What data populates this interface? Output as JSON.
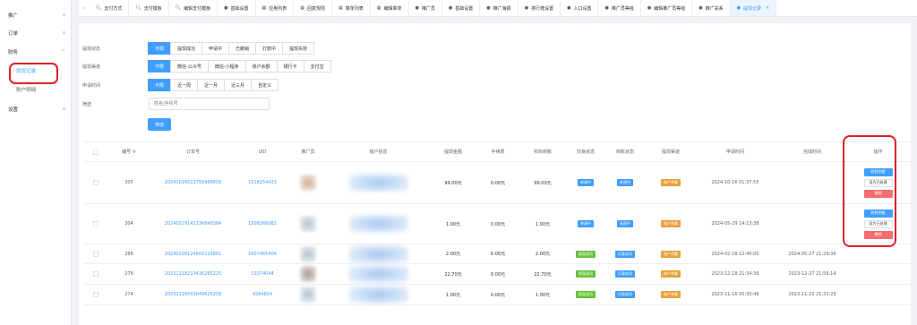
{
  "sidebar": {
    "items": [
      {
        "label": "推广",
        "chevron": "v"
      },
      {
        "label": "订单",
        "chevron": "v"
      },
      {
        "label": "财务",
        "chevron": "^"
      },
      {
        "label": "设置",
        "chevron": "v"
      }
    ],
    "sub_items": [
      {
        "label": "提现记录",
        "active": true
      },
      {
        "label": "账户明细",
        "active": false
      }
    ]
  },
  "tabs": {
    "left_arrow": "‹",
    "items": [
      {
        "label": "支付方式",
        "icon": "search-icon"
      },
      {
        "label": "支付模板",
        "icon": "search-icon"
      },
      {
        "label": "编辑支付模板",
        "icon": "search-icon"
      },
      {
        "label": "基础设置",
        "icon": "dot-icon"
      },
      {
        "label": "应用列表",
        "icon": "grid-icon"
      },
      {
        "label": "回复规则",
        "icon": "grid-icon"
      },
      {
        "label": "菜单列表",
        "icon": "grid-icon"
      },
      {
        "label": "编辑菜单",
        "icon": "grid-icon"
      },
      {
        "label": "推广员",
        "icon": "dot-icon"
      },
      {
        "label": "基础设置",
        "icon": "dot-icon"
      },
      {
        "label": "推广海报",
        "icon": "dot-icon"
      },
      {
        "label": "排行榜设置",
        "icon": "dot-icon"
      },
      {
        "label": "入口设置",
        "icon": "dot-icon"
      },
      {
        "label": "推广员等级",
        "icon": "dot-icon"
      },
      {
        "label": "编辑推广员等级",
        "icon": "dot-icon"
      },
      {
        "label": "推广关系",
        "icon": "dot-icon"
      },
      {
        "label": "提现记录",
        "icon": "dot-icon",
        "active": true,
        "close": "×"
      }
    ]
  },
  "filters": {
    "status": {
      "label": "提现状态",
      "options": [
        "不限",
        "提现成功",
        "申请中",
        "已撤销",
        "打款中",
        "提现失败"
      ],
      "selected": 0
    },
    "channel": {
      "label": "提现渠道",
      "options": [
        "不限",
        "微信-公众号",
        "微信-小程序",
        "账户余额",
        "银行卡",
        "支付宝"
      ],
      "selected": 0
    },
    "time": {
      "label": "申请时间",
      "options": [
        "不限",
        "近一周",
        "近一月",
        "近三月",
        "自定义"
      ],
      "selected": 0
    },
    "search": {
      "label": "筛选",
      "placeholder": "姓名/手机号"
    },
    "submit_label": "筛选"
  },
  "table": {
    "columns": [
      "",
      "编号 ≑",
      "订单号",
      "UID",
      "推广员",
      "账户信息",
      "提现金额",
      "手续费",
      "实际到账",
      "交易状态",
      "到账状态",
      "提现渠道",
      "申请时间",
      "完成时间",
      "操作"
    ],
    "rows": [
      {
        "id": "305",
        "order_no": "20241016013755966658",
        "uid": "1518254433",
        "amount": "99.00元",
        "fee": "0.00元",
        "actual": "99.00元",
        "trade_status": {
          "text": "申请中",
          "color": "blue"
        },
        "arrive_status": {
          "text": "处理中",
          "color": "blue"
        },
        "channel": {
          "text": "账户余额",
          "color": "orange"
        },
        "apply_time": "2024-10-16 01:37:55",
        "done_time": "",
        "ops": [
          "转到余额",
          "设为已处理",
          "撤销"
        ],
        "avatar": "b1"
      },
      {
        "id": "304",
        "order_no": "20240529141336848384",
        "uid": "1508266082",
        "amount": "1.00元",
        "fee": "0.00元",
        "actual": "1.00元",
        "trade_status": {
          "text": "申请中",
          "color": "blue"
        },
        "arrive_status": {
          "text": "处理中",
          "color": "blue"
        },
        "channel": {
          "text": "账户余额",
          "color": "orange"
        },
        "apply_time": "2024-05-29 14:13:38",
        "done_time": "",
        "ops": [
          "转到余额",
          "设为已处理",
          "撤销"
        ],
        "avatar": "b2"
      },
      {
        "id": "288",
        "order_no": "20240228124600224861",
        "uid": "1607465406",
        "amount": "2.00元",
        "fee": "0.00元",
        "actual": "2.00元",
        "trade_status": {
          "text": "提现成功",
          "color": "green"
        },
        "arrive_status": {
          "text": "打款成功",
          "color": "blue"
        },
        "channel": {
          "text": "账户余额",
          "color": "orange"
        },
        "apply_time": "2024-02-28 12:46:00",
        "done_time": "2024-05-27 21:29:36",
        "ops": [],
        "avatar": "b2"
      },
      {
        "id": "278",
        "order_no": "20231218213436285225",
        "uid": "13374044",
        "amount": "22.70元",
        "fee": "0.00元",
        "actual": "22.70元",
        "trade_status": {
          "text": "提现成功",
          "color": "green"
        },
        "arrive_status": {
          "text": "打款成功",
          "color": "blue"
        },
        "channel": {
          "text": "账户余额",
          "color": "orange"
        },
        "apply_time": "2023-12-18 21:34:36",
        "done_time": "2023-12-27 21:56:14",
        "ops": [],
        "avatar": "b3"
      },
      {
        "id": "274",
        "order_no": "20231116003049625258",
        "uid": "4284654",
        "amount": "1.00元",
        "fee": "0.00元",
        "actual": "1.00元",
        "trade_status": {
          "text": "提现成功",
          "color": "green"
        },
        "arrive_status": {
          "text": "打款成功",
          "color": "blue"
        },
        "channel": {
          "text": "账户余额",
          "color": "orange"
        },
        "apply_time": "2023-11-16 00:30:49",
        "done_time": "2023-11-22 21:32:29",
        "ops": [],
        "avatar": "b2"
      }
    ]
  },
  "colors": {
    "primary": "#409eff",
    "success": "#67c23a",
    "warning": "#e6a23c",
    "danger": "#f56c6c",
    "highlight": "#e01e2a"
  }
}
